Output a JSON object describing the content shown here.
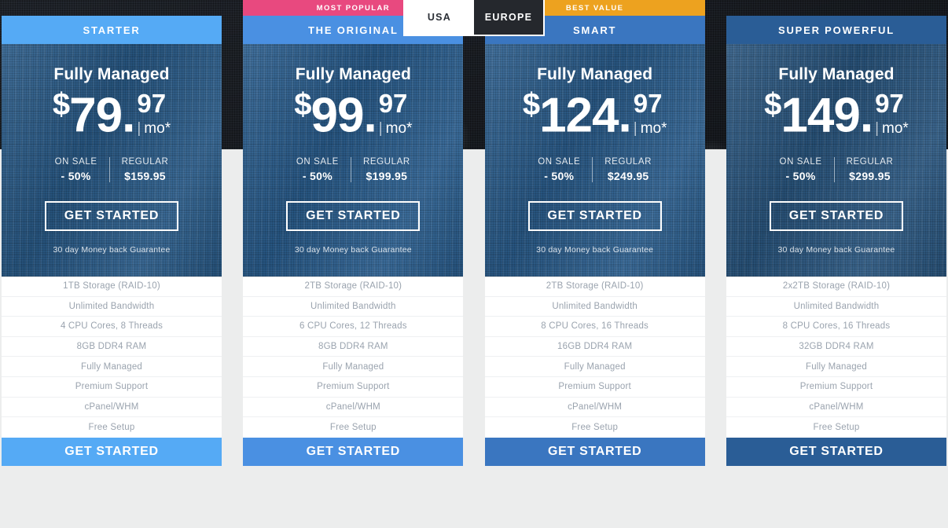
{
  "region_toggle": {
    "tabs": [
      {
        "label": "USA",
        "active": true
      },
      {
        "label": "EUROPE",
        "active": false
      }
    ]
  },
  "colors": {
    "page_background": "#1c2026",
    "panel_background": "#eceded",
    "badge_most_popular": "#e8497f",
    "badge_best_value": "#eda21f",
    "card1_accent": "#55aaf5",
    "card2_accent": "#4a90e2",
    "card3_accent": "#3a76c0",
    "card4_accent": "#2a5d96",
    "feature_text": "#9aa3ae"
  },
  "plans": [
    {
      "badge": "",
      "name": "STARTER",
      "managed": "Fully Managed",
      "price_currency": "$",
      "price_whole": "79.",
      "price_cents": "97",
      "price_period": "mo*",
      "sale_label": "ON SALE",
      "sale_value": "- 50%",
      "regular_label": "REGULAR",
      "regular_value": "$159.95",
      "cta_top": "GET STARTED",
      "guarantee": "30 day Money back Guarantee",
      "features": [
        "1TB Storage (RAID-10)",
        "Unlimited Bandwidth",
        "4 CPU Cores, 8 Threads",
        "8GB DDR4 RAM",
        "Fully Managed",
        "Premium Support",
        "cPanel/WHM",
        "Free Setup"
      ],
      "cta_bottom": "GET STARTED"
    },
    {
      "badge": "MOST POPULAR",
      "name": "THE ORIGINAL",
      "managed": "Fully Managed",
      "price_currency": "$",
      "price_whole": "99.",
      "price_cents": "97",
      "price_period": "mo*",
      "sale_label": "ON SALE",
      "sale_value": "- 50%",
      "regular_label": "REGULAR",
      "regular_value": "$199.95",
      "cta_top": "GET STARTED",
      "guarantee": "30 day Money back Guarantee",
      "features": [
        "2TB Storage (RAID-10)",
        "Unlimited Bandwidth",
        "6 CPU Cores, 12 Threads",
        "8GB DDR4 RAM",
        "Fully Managed",
        "Premium Support",
        "cPanel/WHM",
        "Free Setup"
      ],
      "cta_bottom": "GET STARTED"
    },
    {
      "badge": "BEST VALUE",
      "name": "SMART",
      "managed": "Fully Managed",
      "price_currency": "$",
      "price_whole": "124.",
      "price_cents": "97",
      "price_period": "mo*",
      "sale_label": "ON SALE",
      "sale_value": "- 50%",
      "regular_label": "REGULAR",
      "regular_value": "$249.95",
      "cta_top": "GET STARTED",
      "guarantee": "30 day Money back Guarantee",
      "features": [
        "2TB Storage (RAID-10)",
        "Unlimited Bandwidth",
        "8 CPU Cores, 16 Threads",
        "16GB DDR4 RAM",
        "Fully Managed",
        "Premium Support",
        "cPanel/WHM",
        "Free Setup"
      ],
      "cta_bottom": "GET STARTED"
    },
    {
      "badge": "",
      "name": "SUPER POWERFUL",
      "managed": "Fully Managed",
      "price_currency": "$",
      "price_whole": "149.",
      "price_cents": "97",
      "price_period": "mo*",
      "sale_label": "ON SALE",
      "sale_value": "- 50%",
      "regular_label": "REGULAR",
      "regular_value": "$299.95",
      "cta_top": "GET STARTED",
      "guarantee": "30 day Money back Guarantee",
      "features": [
        "2x2TB Storage (RAID-10)",
        "Unlimited Bandwidth",
        "8 CPU Cores, 16 Threads",
        "32GB DDR4 RAM",
        "Fully Managed",
        "Premium Support",
        "cPanel/WHM",
        "Free Setup"
      ],
      "cta_bottom": "GET STARTED"
    }
  ]
}
